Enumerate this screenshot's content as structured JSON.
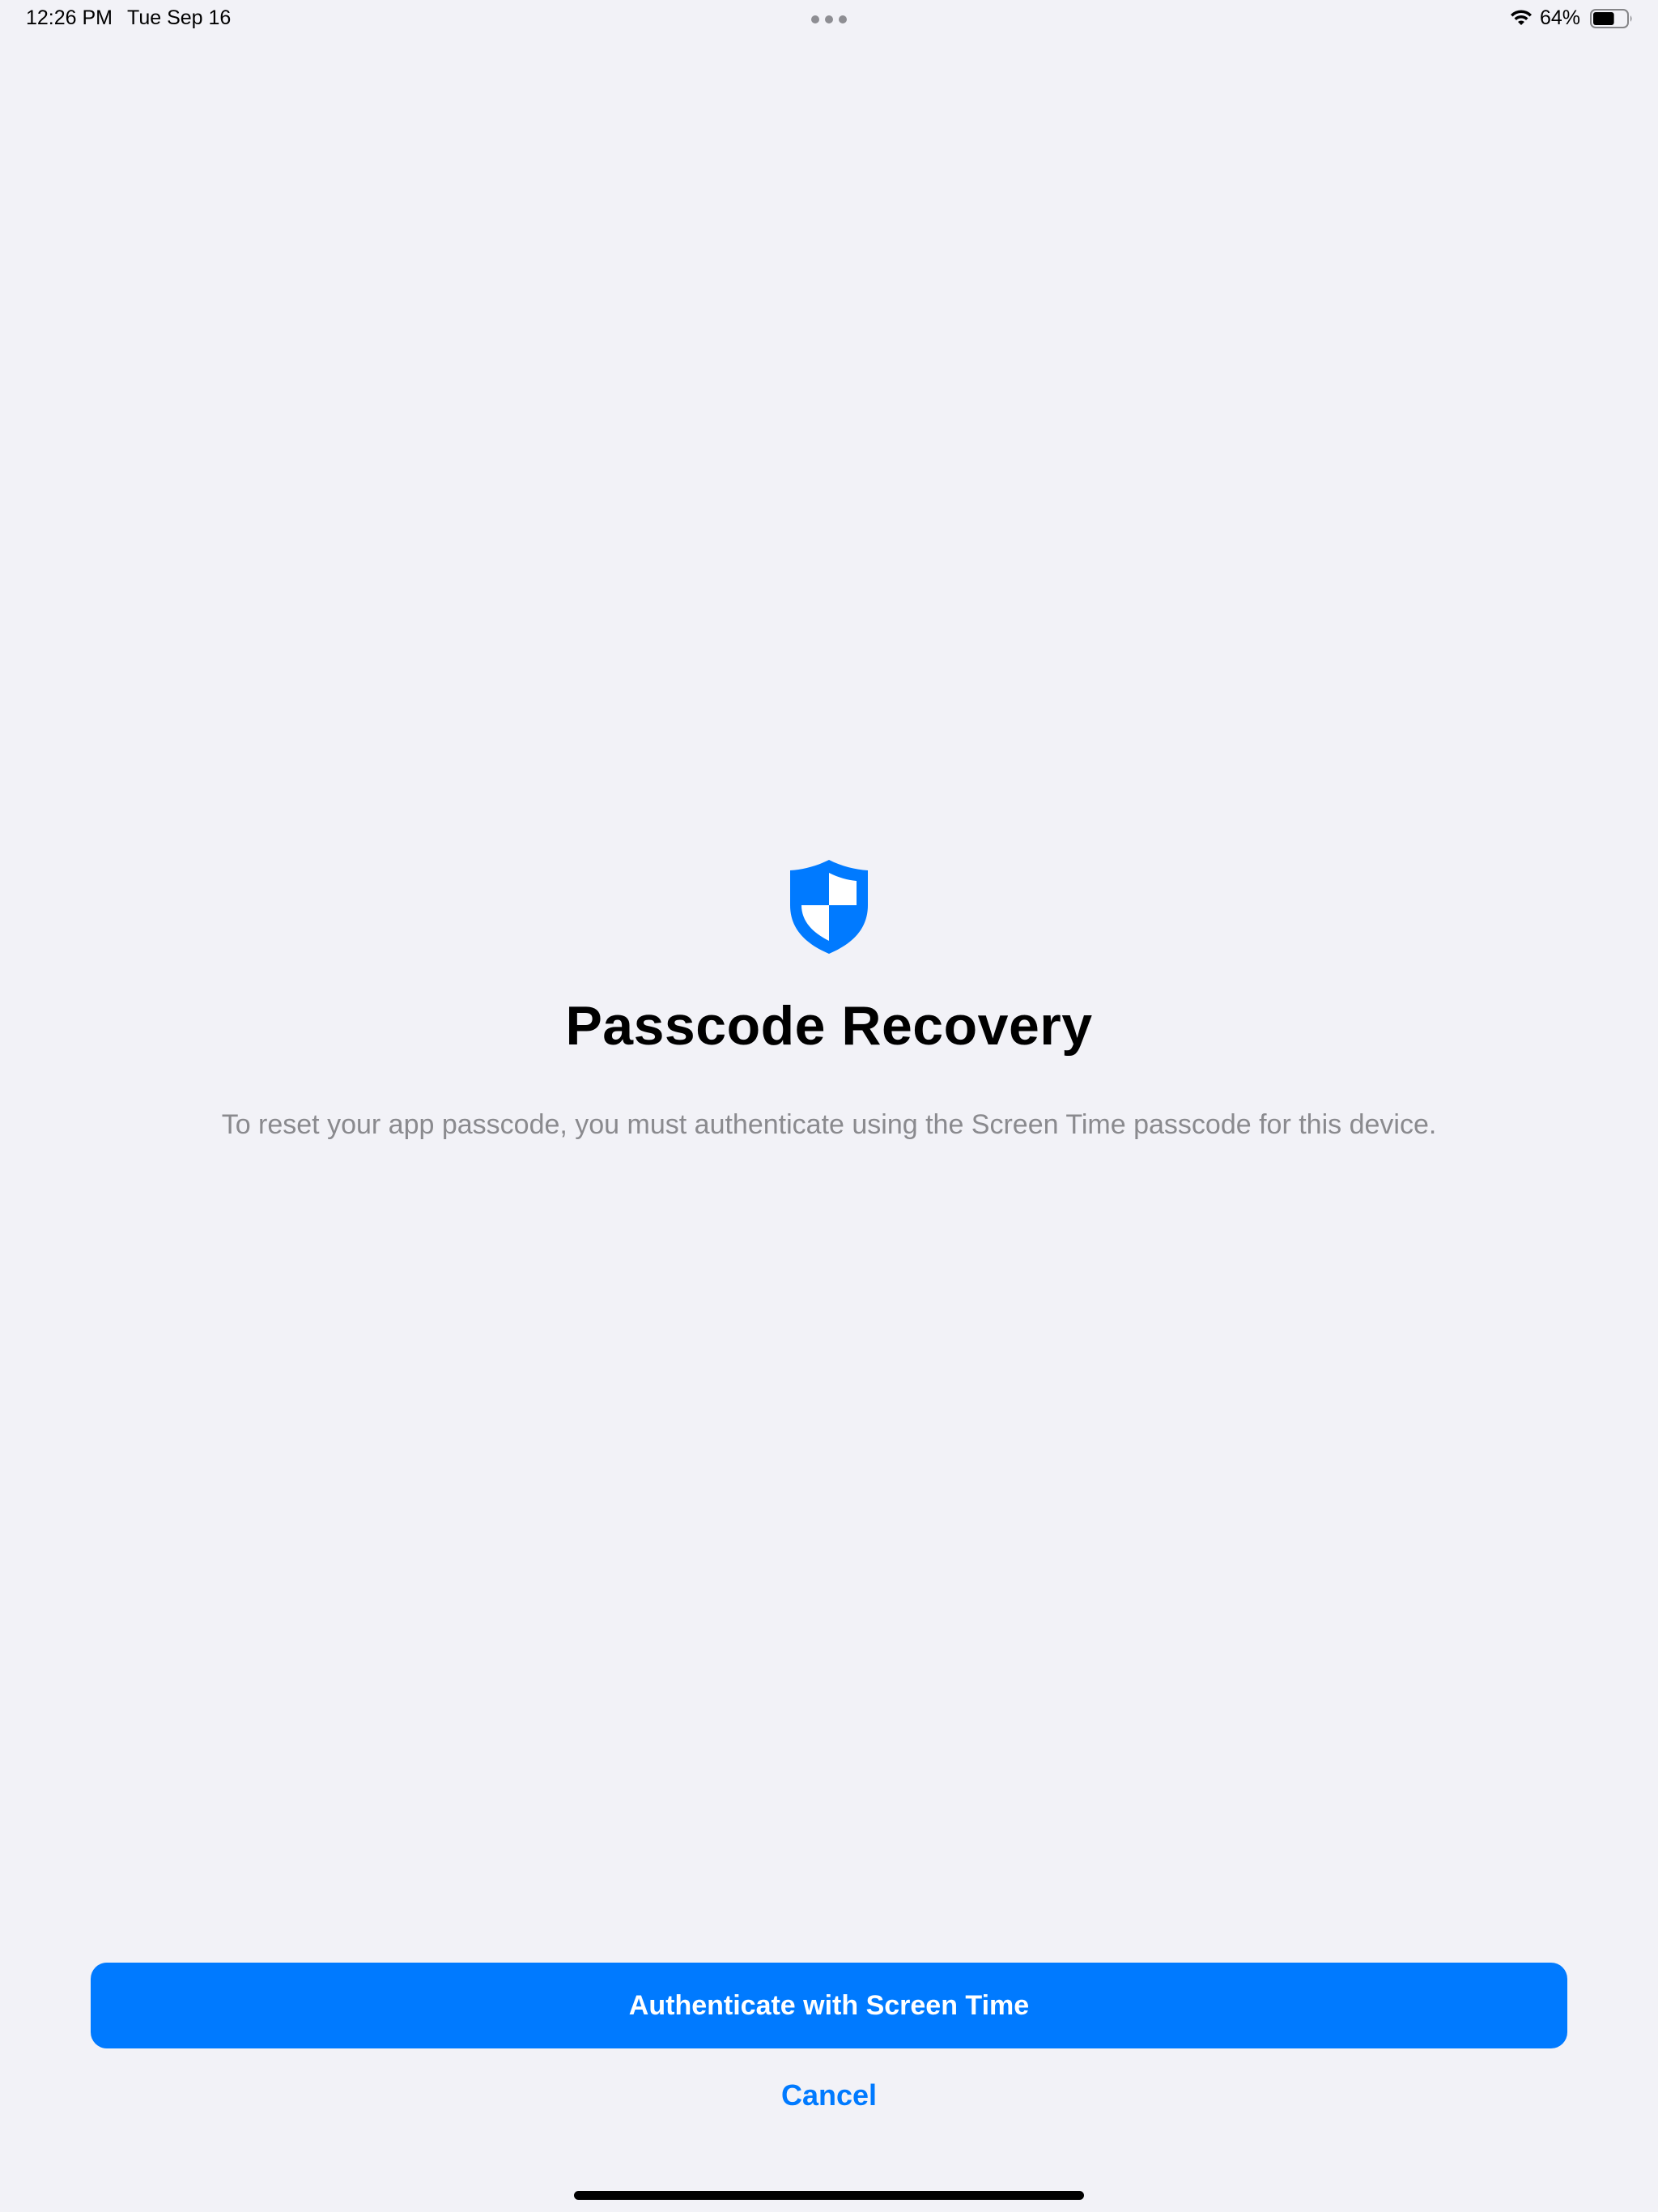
{
  "status_bar": {
    "time": "12:26 PM",
    "date": "Tue Sep 16",
    "battery_percent": "64%",
    "battery_level": 0.64,
    "icons": [
      "wifi-icon",
      "battery-icon",
      "multitask-dots-icon"
    ]
  },
  "main": {
    "icon": "shield-icon",
    "title": "Passcode Recovery",
    "description": "To reset your app passcode, you must authenticate using the Screen Time passcode for this device."
  },
  "actions": {
    "primary_label": "Authenticate with Screen Time",
    "cancel_label": "Cancel"
  },
  "colors": {
    "accent": "#007aff",
    "background": "#f2f2f7",
    "secondary_text": "#8a8a8e"
  }
}
